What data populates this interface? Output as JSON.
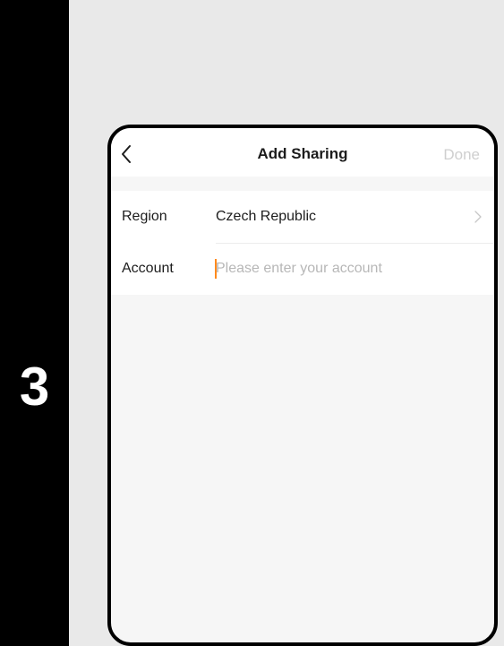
{
  "step": {
    "number": "3"
  },
  "nav": {
    "title": "Add Sharing",
    "done_label": "Done",
    "back_icon": "chevron-left-icon"
  },
  "form": {
    "region": {
      "label": "Region",
      "value": "Czech Republic",
      "icon": "chevron-right-icon"
    },
    "account": {
      "label": "Account",
      "value": "",
      "placeholder": "Please enter your account"
    }
  },
  "colors": {
    "caret": "#ff8a1c",
    "done_disabled": "#cfcfcf",
    "background": "#f6f6f6"
  }
}
